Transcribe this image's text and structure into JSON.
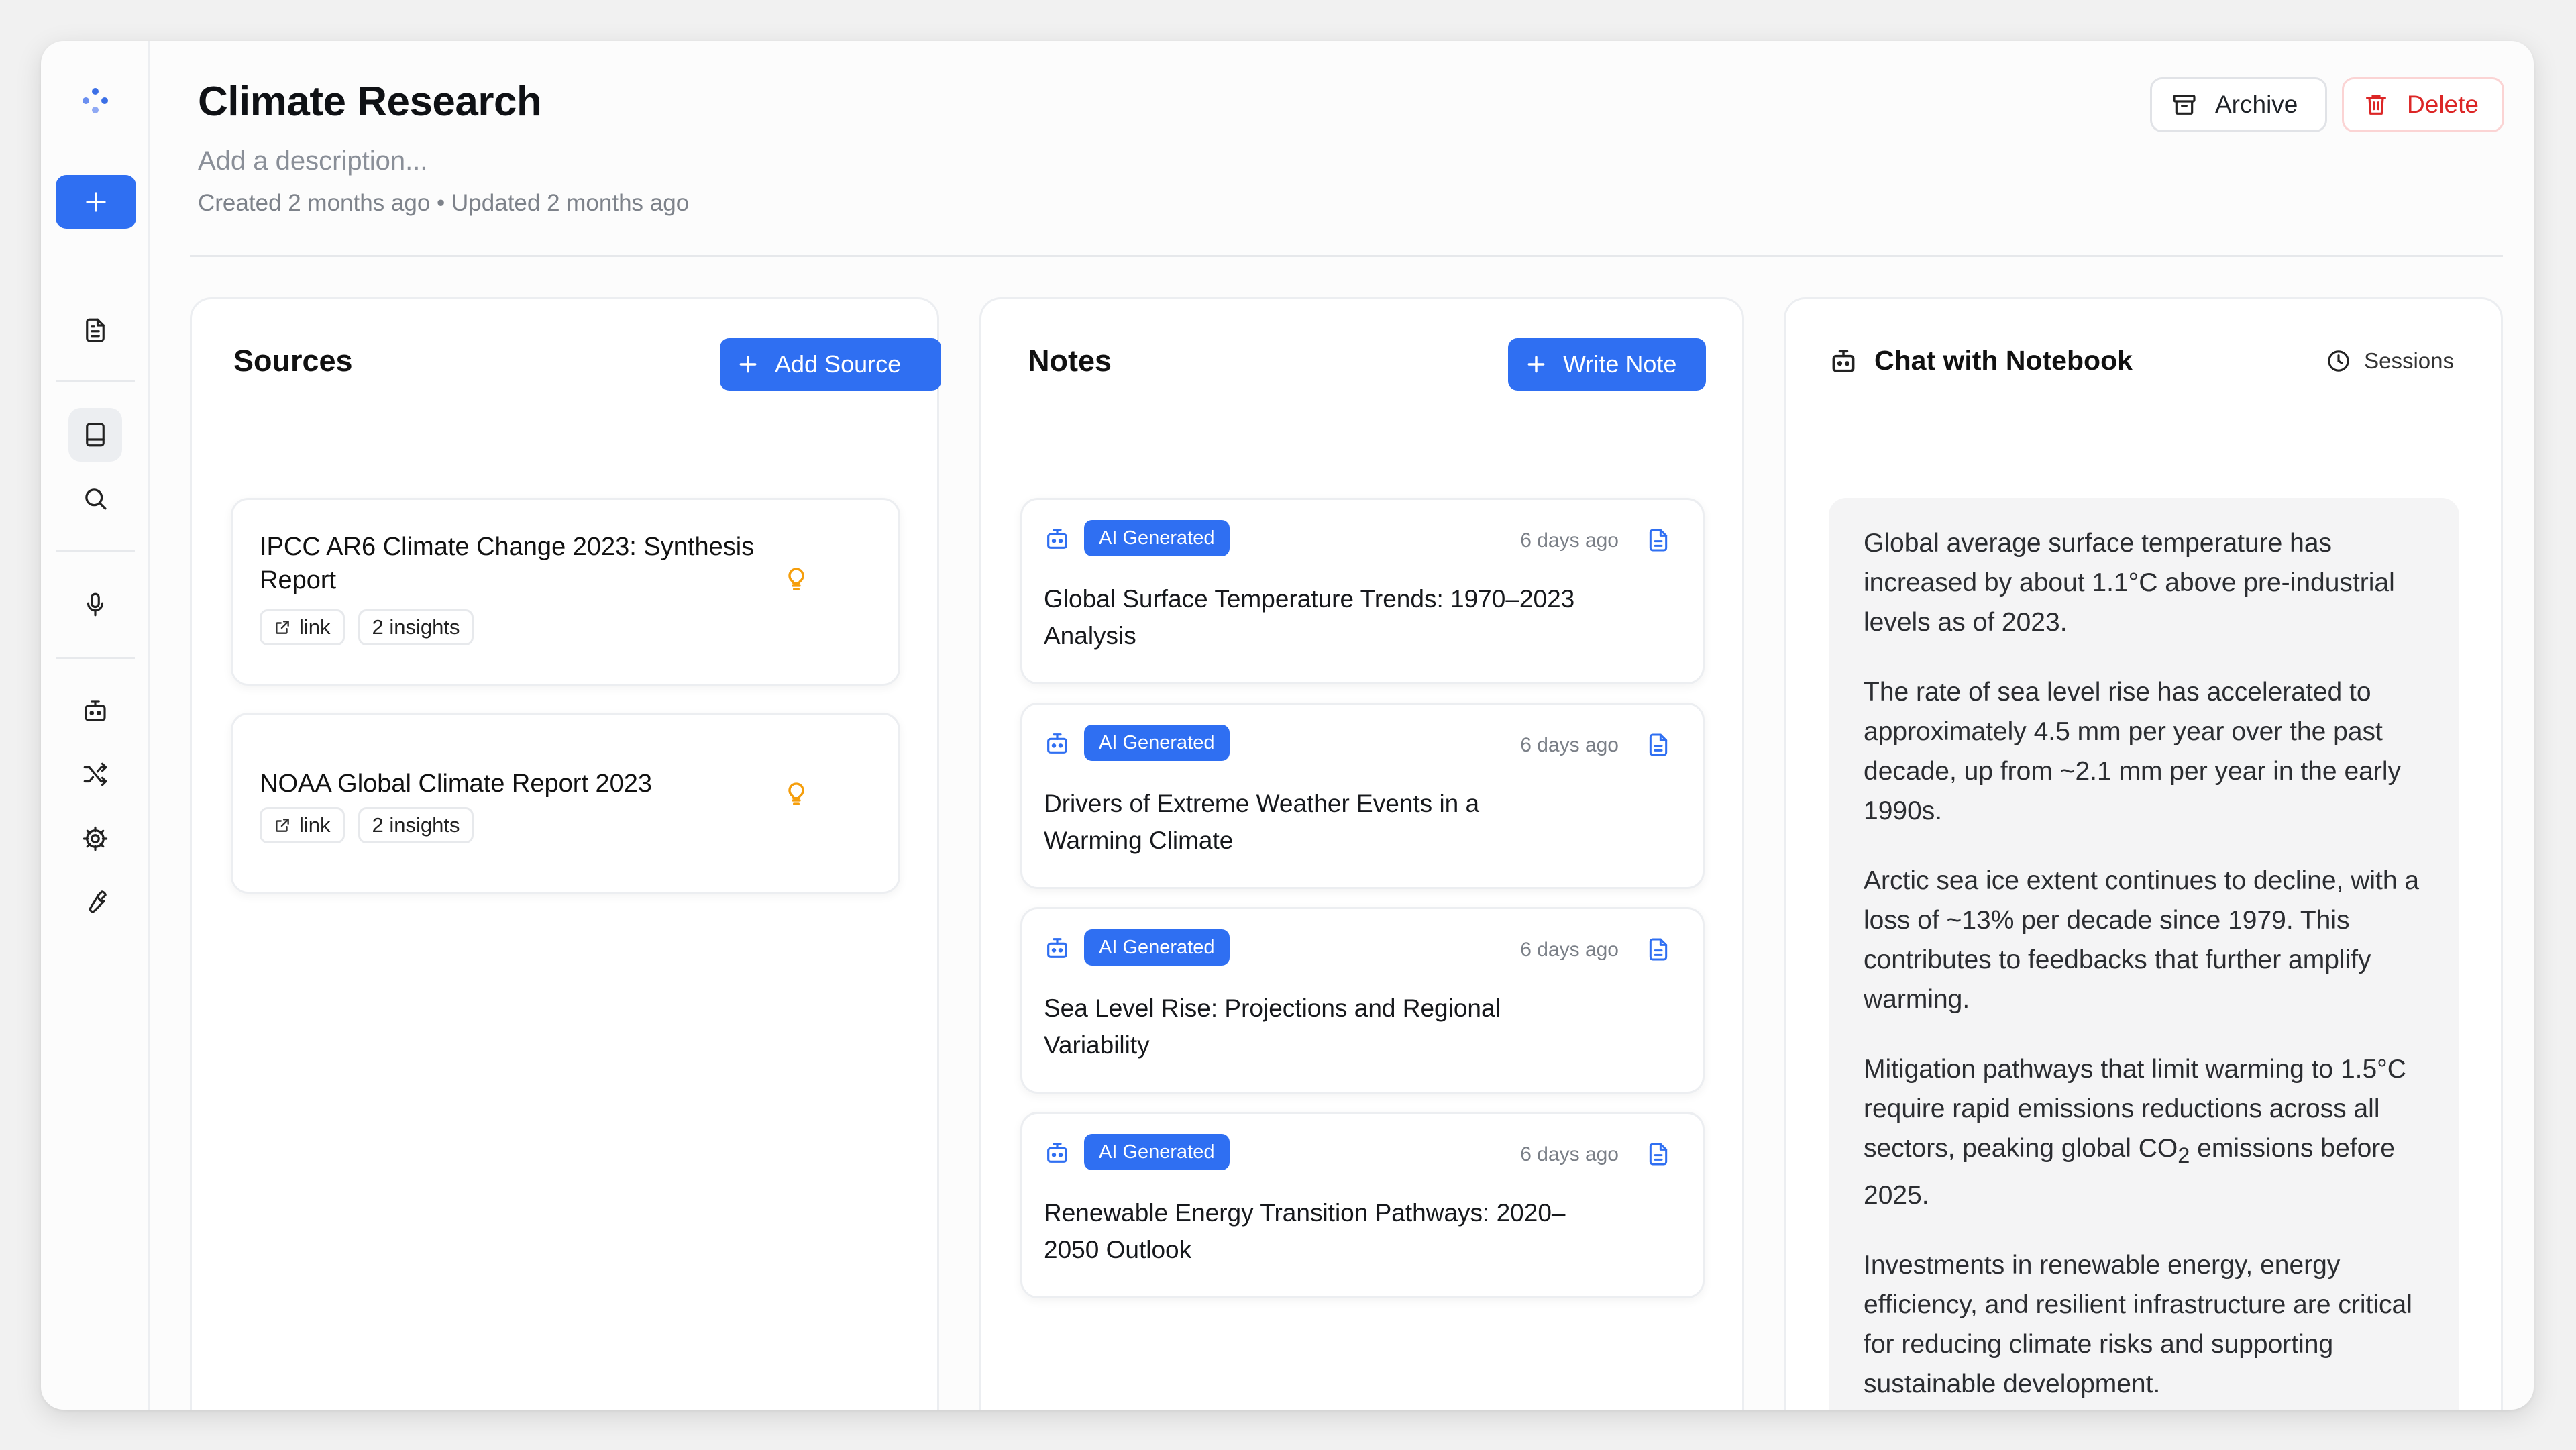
{
  "colors": {
    "accent": "#2f6ff2",
    "danger": "#dc2626",
    "insight": "#f59e0b"
  },
  "sidebar": {
    "logo_icon": "sparkle-logo-icon",
    "new_icon": "plus-icon",
    "items": [
      "document-icon",
      "notebook-icon",
      "search-icon",
      "microphone-icon",
      "robot-icon",
      "shuffle-icon",
      "gear-icon",
      "wrench-icon"
    ]
  },
  "header": {
    "title": "Climate Research",
    "description_placeholder": "Add a description...",
    "meta": "Created 2 months ago • Updated 2 months ago",
    "archive_label": "Archive",
    "delete_label": "Delete"
  },
  "sources": {
    "title": "Sources",
    "add_label": "Add Source",
    "items": [
      {
        "title": "IPCC AR6 Climate Change 2023: Synthesis Report",
        "link_label": "link",
        "insights": "2 insights"
      },
      {
        "title": "NOAA Global Climate Report 2023",
        "link_label": "link",
        "insights": "2 insights"
      }
    ]
  },
  "notes": {
    "title": "Notes",
    "write_label": "Write Note",
    "items": [
      {
        "badge": "AI Generated",
        "time": "6 days ago",
        "title": "Global Surface Temperature Trends: 1970–2023 Analysis"
      },
      {
        "badge": "AI Generated",
        "time": "6 days ago",
        "title": "Drivers of Extreme Weather Events in a Warming Climate"
      },
      {
        "badge": "AI Generated",
        "time": "6 days ago",
        "title": "Sea Level Rise: Projections and Regional Variability"
      },
      {
        "badge": "AI Generated",
        "time": "6 days ago",
        "title": "Renewable Energy Transition Pathways: 2020–2050 Outlook"
      }
    ]
  },
  "chat": {
    "title": "Chat with Notebook",
    "sessions_label": "Sessions",
    "paragraphs": [
      "Global average surface temperature has increased by about 1.1°C above pre-industrial levels as of 2023.",
      "The rate of sea level rise has accelerated to approximately 4.5 mm per year over the past decade, up from ~2.1 mm per year in the early 1990s.",
      "Arctic sea ice extent continues to decline, with a loss of ~13% per decade since 1979. This contributes to feedbacks that further amplify warming."
    ],
    "p4_prefix": "Mitigation pathways that limit warming to 1.5°C require rapid emissions reductions across all sectors, peaking global CO",
    "p4_sub": "2",
    "p4_suffix": " emissions before 2025.",
    "p5": "Investments in renewable energy, energy efficiency, and resilient infrastructure are critical for reducing climate risks and supporting sustainable development."
  }
}
